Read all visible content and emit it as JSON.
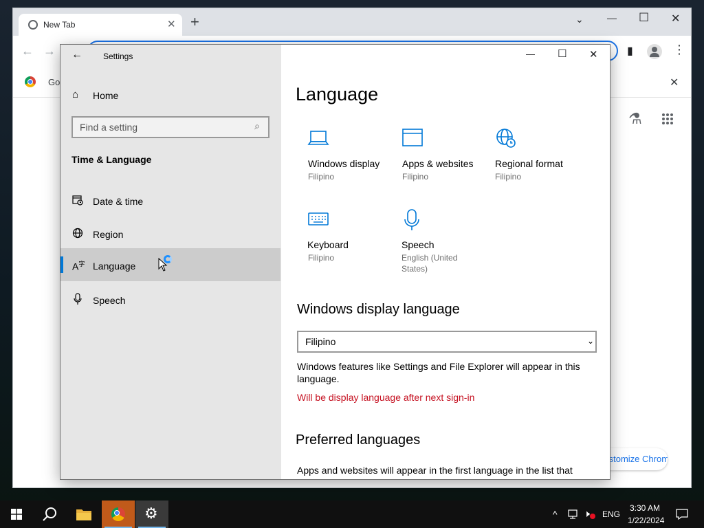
{
  "chrome": {
    "tab_title": "New Tab",
    "bookmark_label": "Go",
    "customize_label": "Customize Chrome",
    "minimize_glyph": "—",
    "maximize_glyph": "☐",
    "close_glyph": "✕"
  },
  "settings": {
    "window_title": "Settings",
    "sidebar": {
      "home_label": "Home",
      "search_placeholder": "Find a setting",
      "section_title": "Time & Language",
      "items": [
        {
          "label": "Date & time",
          "icon": "calendar-clock-icon"
        },
        {
          "label": "Region",
          "icon": "globe-icon"
        },
        {
          "label": "Language",
          "icon": "language-icon",
          "selected": true
        },
        {
          "label": "Speech",
          "icon": "microphone-icon"
        }
      ]
    },
    "main": {
      "title": "Language",
      "tiles": [
        {
          "label": "Windows display",
          "sub": "Filipino",
          "icon": "laptop-icon"
        },
        {
          "label": "Apps & websites",
          "sub": "Filipino",
          "icon": "window-icon"
        },
        {
          "label": "Regional format",
          "sub": "Filipino",
          "icon": "globe-clock-icon"
        },
        {
          "label": "Keyboard",
          "sub": "Filipino",
          "icon": "keyboard-icon"
        },
        {
          "label": "Speech",
          "sub": "English (United States)",
          "icon": "microphone-icon"
        }
      ],
      "display_language_heading": "Windows display language",
      "display_language_value": "Filipino",
      "display_language_desc": "Windows features like Settings and File Explorer will appear in this language.",
      "display_language_warning": "Will be display language after next sign-in",
      "preferred_heading": "Preferred languages",
      "preferred_desc": "Apps and websites will appear in the first language in the list that"
    }
  },
  "taskbar": {
    "time": "3:30 AM",
    "date": "1/22/2024",
    "input_language": "ENG"
  },
  "colors": {
    "accent": "#0078d7",
    "warning": "#c50f1f",
    "chrome_blue": "#1a73e8"
  }
}
